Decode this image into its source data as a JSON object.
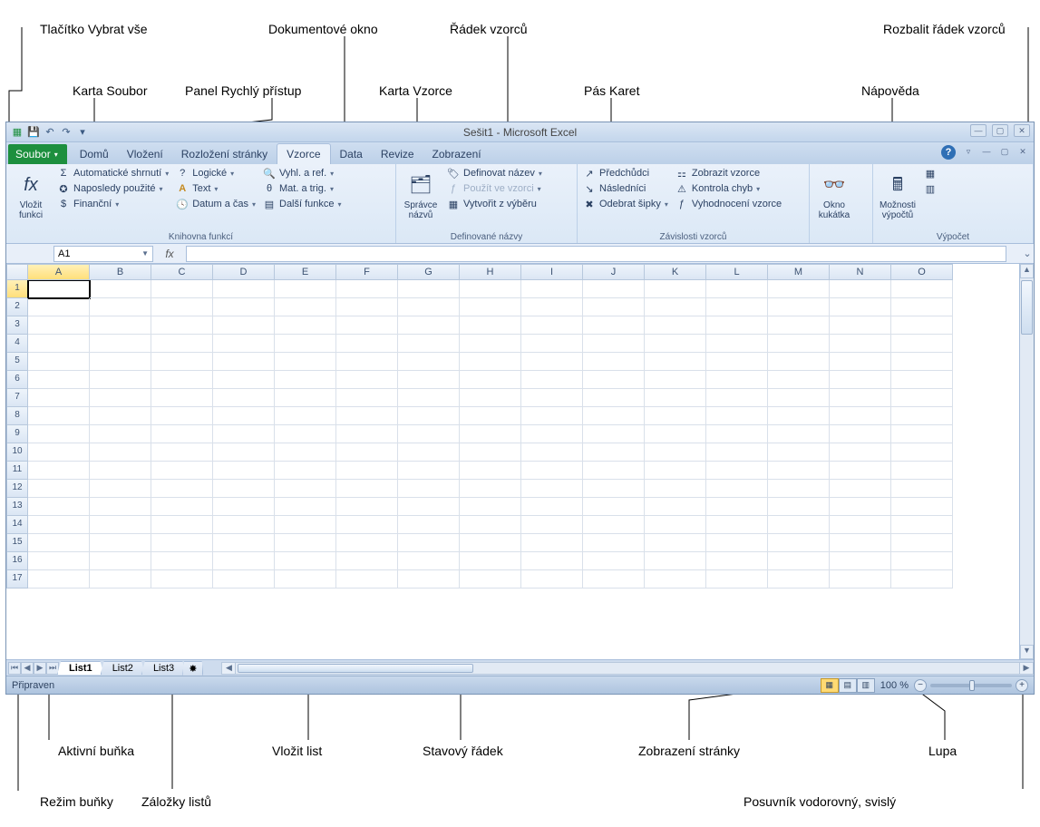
{
  "callouts": {
    "select_all": "Tlačítko Vybrat vše",
    "doc_window": "Dokumentové okno",
    "formula_bar": "Řádek vzorců",
    "expand_formula": "Rozbalit řádek vzorců",
    "file_tab": "Karta Soubor",
    "qat": "Panel Rychlý přístup",
    "formulas_tab": "Karta Vzorce",
    "ribbon": "Pás Karet",
    "help": "Nápověda",
    "active_cell": "Aktivní buňka",
    "insert_sheet": "Vložit list",
    "status_bar": "Stavový řádek",
    "page_views": "Zobrazení stránky",
    "zoom": "Lupa",
    "cell_mode": "Režim buňky",
    "sheet_tabs": "Záložky listů",
    "scrollbars": "Posuvník vodorovný, svislý"
  },
  "title": "Sešit1  -  Microsoft Excel",
  "tabs": {
    "file": "Soubor",
    "home": "Domů",
    "insert": "Vložení",
    "layout": "Rozložení stránky",
    "formulas": "Vzorce",
    "data": "Data",
    "review": "Revize",
    "view": "Zobrazení"
  },
  "ribbon": {
    "insert_fn": "Vložit\nfunkci",
    "autosum": "Automatické shrnutí",
    "recent": "Naposledy použité",
    "financial": "Finanční",
    "logical": "Logické",
    "text": "Text",
    "datetime": "Datum a čas",
    "lookup": "Vyhl. a ref.",
    "math": "Mat. a trig.",
    "more": "Další funkce",
    "lib_label": "Knihovna funkcí",
    "name_mgr": "Správce\nnázvů",
    "define": "Definovat název",
    "use": "Použít ve vzorci",
    "create": "Vytvořit z výběru",
    "names_label": "Definované názvy",
    "precedents": "Předchůdci",
    "dependents": "Následníci",
    "remove_arrows": "Odebrat šipky",
    "show_formulas": "Zobrazit vzorce",
    "error_check": "Kontrola chyb",
    "evaluate": "Vyhodnocení vzorce",
    "audit_label": "Závislosti vzorců",
    "watch": "Okno\nkukátka",
    "calc_opts": "Možnosti\nvýpočtů",
    "calc_label": "Výpočet"
  },
  "name_box": "A1",
  "fx": "fx",
  "columns": [
    "A",
    "B",
    "C",
    "D",
    "E",
    "F",
    "G",
    "H",
    "I",
    "J",
    "K",
    "L",
    "M",
    "N",
    "O"
  ],
  "rows": [
    1,
    2,
    3,
    4,
    5,
    6,
    7,
    8,
    9,
    10,
    11,
    12,
    13,
    14,
    15,
    16,
    17
  ],
  "sheets": {
    "s1": "List1",
    "s2": "List2",
    "s3": "List3"
  },
  "status": "Připraven",
  "zoom": "100 %"
}
